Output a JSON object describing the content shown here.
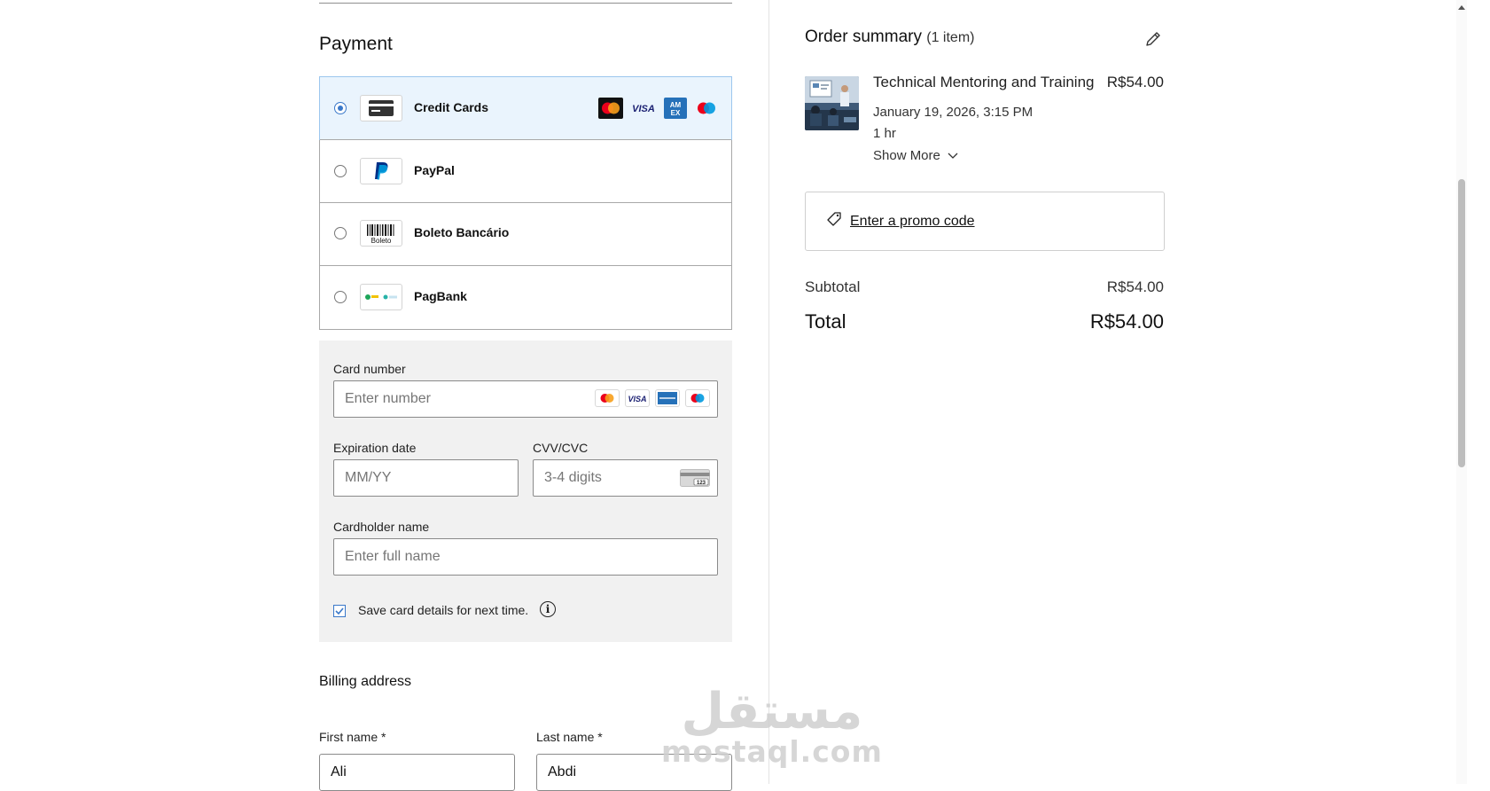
{
  "payment": {
    "title": "Payment",
    "methods": [
      {
        "label": "Credit Cards",
        "selected": true,
        "logo_icon": "credit-card-icon"
      },
      {
        "label": "PayPal",
        "selected": false,
        "logo_icon": "paypal-logo-icon"
      },
      {
        "label": "Boleto Bancário",
        "selected": false,
        "logo_icon": "boleto-barcode-icon",
        "logo_text": "Boleto"
      },
      {
        "label": "PagBank",
        "selected": false,
        "logo_icon": "pagbank-logo-icon"
      }
    ],
    "card_brands": [
      "mastercard-icon",
      "visa-icon",
      "amex-icon",
      "maestro-icon"
    ]
  },
  "card_form": {
    "card_number_label": "Card number",
    "card_number_placeholder": "Enter number",
    "expiration_label": "Expiration date",
    "expiration_placeholder": "MM/YY",
    "cvv_label": "CVV/CVC",
    "cvv_placeholder": "3-4 digits",
    "cvv_icon_text": "123",
    "cardholder_label": "Cardholder name",
    "cardholder_placeholder": "Enter full name",
    "save_label": "Save card details for next time.",
    "save_checked": true
  },
  "billing": {
    "title": "Billing address",
    "first_name_label": "First name *",
    "first_name_value": "Ali",
    "last_name_label": "Last name *",
    "last_name_value": "Abdi"
  },
  "order_summary": {
    "title": "Order summary",
    "count": "(1 item)",
    "item": {
      "name": "Technical Mentoring and Training",
      "price": "R$54.00",
      "date": "January 19, 2026, 3:15 PM",
      "duration": "1 hr",
      "show_more": "Show More"
    },
    "promo_label": "Enter a promo code",
    "subtotal_label": "Subtotal",
    "subtotal_value": "R$54.00",
    "total_label": "Total",
    "total_value": "R$54.00"
  },
  "watermark": {
    "arabic": "مستقل",
    "latin": "mostaql.com"
  },
  "colors": {
    "selected_bg": "#eaf4fd",
    "accent": "#3a78c9",
    "form_bg": "#f1f1f1"
  }
}
